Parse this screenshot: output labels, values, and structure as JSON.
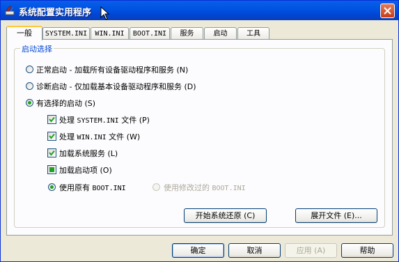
{
  "window": {
    "title": "系统配置实用程序",
    "app_icon": "msconfig-icon",
    "close_icon": "close-icon"
  },
  "tabs": [
    {
      "label": "一般",
      "active": true
    },
    {
      "label": "SYSTEM.INI"
    },
    {
      "label": "WIN.INI"
    },
    {
      "label": "BOOT.INI"
    },
    {
      "label": "服务"
    },
    {
      "label": "启动"
    },
    {
      "label": "工具"
    }
  ],
  "startup_group": {
    "title": "启动选择",
    "normal": {
      "label": "正常启动 - 加载所有设备驱动程序和服务 (N)",
      "selected": false
    },
    "diagnostic": {
      "label": "诊断启动 - 仅加载基本设备驱动程序和服务 (D)",
      "selected": false
    },
    "selective": {
      "label": "有选择的启动 (S)",
      "selected": true
    },
    "options": {
      "process_system_ini": {
        "prefix": "处理",
        "file": "SYSTEM.INI",
        "suffix": "文件 (P)",
        "checked": true
      },
      "process_win_ini": {
        "prefix": "处理",
        "file": "WIN.INI",
        "suffix": "文件 (W)",
        "checked": true
      },
      "load_services": {
        "label": "加载系统服务 (L)",
        "checked": true
      },
      "load_startup": {
        "label": "加载启动项 (O)",
        "state": "indeterminate"
      }
    },
    "use_original_boot": {
      "prefix": "使用原有",
      "file": "BOOT.INI",
      "selected": true
    },
    "use_modified_boot": {
      "prefix": "使用修改过的",
      "file": "BOOT.INI",
      "selected": false,
      "disabled": true
    },
    "restore_button": "开始系统还原 (C)",
    "expand_button": "展开文件 (E)..."
  },
  "footer": {
    "ok": "确定",
    "cancel": "取消",
    "apply": "应用 (A)",
    "help": "帮助"
  },
  "colors": {
    "title_bar": "#0054e3",
    "accent_green": "#21a121",
    "group_title": "#0046d5",
    "dialog_bg": "#ece9d8"
  }
}
